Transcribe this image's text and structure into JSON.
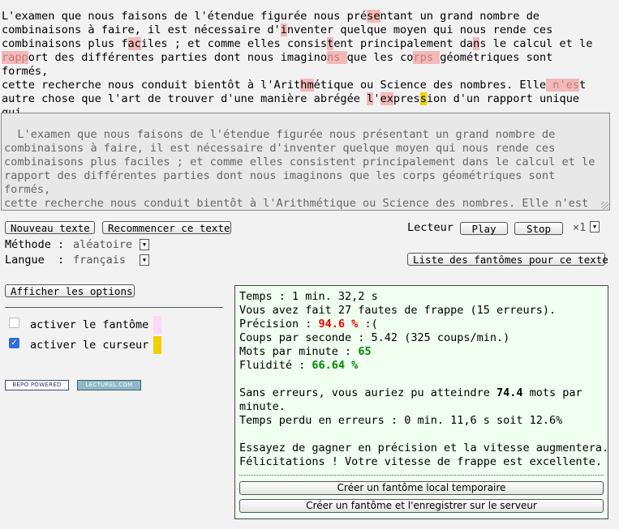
{
  "source_text": {
    "segments": [
      {
        "t": "L'examen que nous faisons de l'étendue figurée nous pré",
        "s": ""
      },
      {
        "t": "se",
        "s": "err"
      },
      {
        "t": "ntant un grand nombre de\ncombinaisons à faire, il est nécessaire d'",
        "s": ""
      },
      {
        "t": "i",
        "s": "err"
      },
      {
        "t": "nventer quelque moyen qui nous rende ces\ncombinaisons plus f",
        "s": ""
      },
      {
        "t": "ac",
        "s": "err"
      },
      {
        "t": "iles ; et comme elles consis",
        "s": ""
      },
      {
        "t": "t",
        "s": "err"
      },
      {
        "t": "ent principalement da",
        "s": ""
      },
      {
        "t": "n",
        "s": "err"
      },
      {
        "t": "s le calcul et le\n",
        "s": ""
      },
      {
        "t": "rapp",
        "s": "errtxt"
      },
      {
        "t": "ort des différentes parties dont nous imagino",
        "s": ""
      },
      {
        "t": "ns ",
        "s": "errtxt"
      },
      {
        "t": "que les co",
        "s": ""
      },
      {
        "t": "rps ",
        "s": "errtxt"
      },
      {
        "t": "géométriques sont formés,\ncette recherche nous conduit bientôt à l'Arit",
        "s": ""
      },
      {
        "t": "hm",
        "s": "err"
      },
      {
        "t": "étique ou Science des nombres. Elle",
        "s": ""
      },
      {
        "t": " n'es",
        "s": "errtxt"
      },
      {
        "t": "t\nautre chose que l'art de trouver d'une manière abrégée ",
        "s": ""
      },
      {
        "t": "l",
        "s": "err"
      },
      {
        "t": "'",
        "s": ""
      },
      {
        "t": "ex",
        "s": "err"
      },
      {
        "t": "pres",
        "s": ""
      },
      {
        "t": "s",
        "s": "cur"
      },
      {
        "t": "ion d'un rapport unique\nqui...",
        "s": ""
      }
    ]
  },
  "typed_text": "L'examen que nous faisons de l'étendue figurée nous présentant un grand nombre de\ncombinaisons à faire, il est nécessaire d'inventer quelque moyen qui nous rende ces\ncombinaisons plus faciles ; et comme elles consistent principalement dans le calcul et le\nrapport des différentes parties dont nous imaginons que les corps géométriques sont formés,\ncette recherche nous conduit bientôt à l'Arithmétique ou Science des nombres. Elle n'est\nautre chose que l'art de trouver d'une manière abrégée l'expres",
  "toolbar": {
    "new_text": "Nouveau texte",
    "restart_text": "Recommencer ce texte",
    "reader_label": "Lecteur",
    "play": "Play",
    "stop": "Stop",
    "speed": "×1",
    "method_label": "Méthode :",
    "method_value": "aléatoire",
    "language_label": "Langue  :",
    "language_value": "français",
    "ghost_list": "Liste des fantômes pour ce texte"
  },
  "options": {
    "show_options": "Afficher les options",
    "ghost_label": "activer le fantôme",
    "ghost_checked": false,
    "ghost_color": "#ffd8f4",
    "cursor_label": "activer le curseur",
    "cursor_checked": true,
    "cursor_color": "#f0d000",
    "badge_bepo": "BÉPO POWERED",
    "badge_lecturel": "LECTUREL.COM"
  },
  "stats": {
    "time_label": "Temps : ",
    "time_value": "1 min. 32,2 s",
    "faults": "Vous avez fait 27 fautes de frappe (15 erreurs).",
    "precision_label": "Précision : ",
    "precision_value": "94.6 %",
    "precision_face": " :(",
    "cps": "Coups par seconde : 5.42 (325 coups/min.)",
    "wpm_label": "Mots par minute : ",
    "wpm_value": "65",
    "fluidity_label": "Fluidité : ",
    "fluidity_value": "66.64 %",
    "no_errors_1a": "Sans erreurs, vous auriez pu atteindre ",
    "no_errors_value": "74.4",
    "no_errors_1b": " mots par",
    "no_errors_2": "minute.",
    "lost_time": "Temps perdu en erreurs : 0 min. 11,6 s soit 12.6%",
    "advice_1": "Essayez de gagner en précision et la vitesse augmentera.",
    "advice_2": "Félicitations ! Votre vitesse de frappe est excellente.",
    "btn_local_ghost": "Créer un fantôme local temporaire",
    "btn_server_ghost": "Créer un fantôme et l'enregistrer sur le serveur"
  }
}
